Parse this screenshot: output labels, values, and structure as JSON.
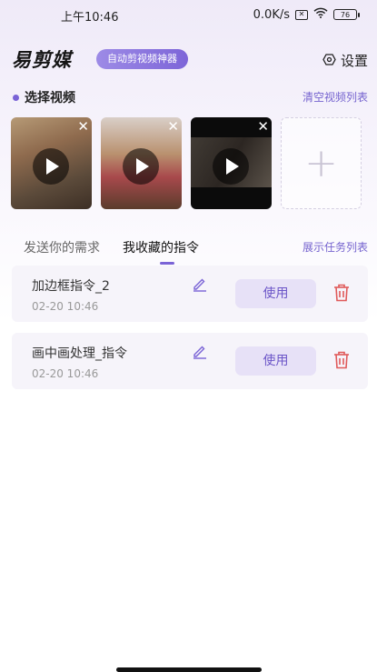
{
  "status_bar": {
    "time": "上午10:46",
    "net_speed": "0.0K/s",
    "sim_label": "✕",
    "battery": "76"
  },
  "header": {
    "logo": "易剪媒",
    "slogan": "自动剪视频神器",
    "settings_label": "设置"
  },
  "video_section": {
    "title": "选择视频",
    "clear_label": "清空视频列表",
    "add_symbol": "+",
    "close_symbol": "✕"
  },
  "tabs": {
    "items": [
      {
        "label": "发送你的需求"
      },
      {
        "label": "我收藏的指令"
      }
    ],
    "active_index": 1,
    "tasks_label": "展示任务列表"
  },
  "commands": [
    {
      "name": "加边框指令_2",
      "time": "02-20 10:46",
      "use_label": "使用"
    },
    {
      "name": "画中画处理_指令",
      "time": "02-20 10:46",
      "use_label": "使用"
    }
  ],
  "colors": {
    "accent": "#7a63d6",
    "danger": "#e05a5a",
    "card_bg": "#f6f4fa"
  }
}
